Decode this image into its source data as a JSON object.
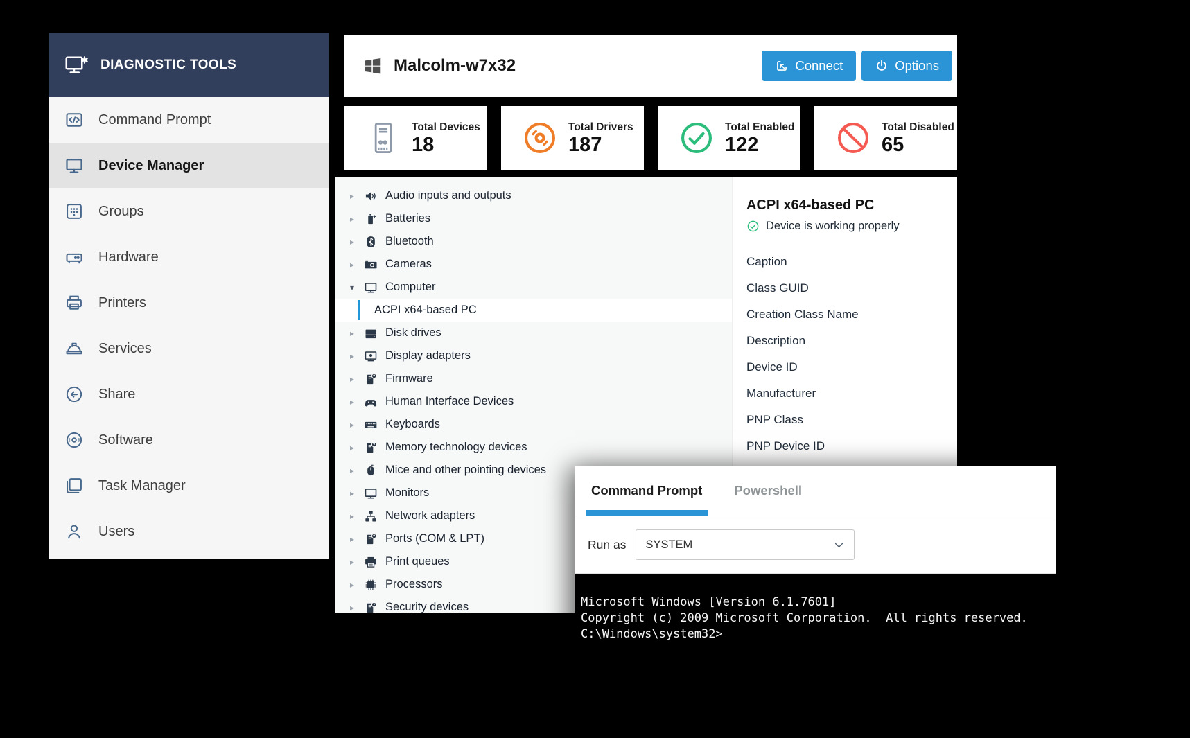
{
  "sidebar": {
    "title": "DIAGNOSTIC TOOLS",
    "items": [
      {
        "label": "Command Prompt",
        "icon": "command-prompt",
        "active": false
      },
      {
        "label": "Device Manager",
        "icon": "device-manager",
        "active": true
      },
      {
        "label": "Groups",
        "icon": "groups",
        "active": false
      },
      {
        "label": "Hardware",
        "icon": "hardware",
        "active": false
      },
      {
        "label": "Printers",
        "icon": "printers",
        "active": false
      },
      {
        "label": "Services",
        "icon": "services",
        "active": false
      },
      {
        "label": "Share",
        "icon": "share",
        "active": false
      },
      {
        "label": "Software",
        "icon": "software",
        "active": false
      },
      {
        "label": "Task Manager",
        "icon": "task-manager",
        "active": false
      },
      {
        "label": "Users",
        "icon": "users",
        "active": false
      }
    ]
  },
  "header": {
    "device_name": "Malcolm-w7x32",
    "connect_label": "Connect",
    "options_label": "Options"
  },
  "stats": [
    {
      "label": "Total Devices",
      "value": "18",
      "icon": "pc-tower",
      "color": "#8e9aa9"
    },
    {
      "label": "Total Drivers",
      "value": "187",
      "icon": "disc",
      "color": "#ef7d28"
    },
    {
      "label": "Total Enabled",
      "value": "122",
      "icon": "check-circle",
      "color": "#2cbd7d"
    },
    {
      "label": "Total Disabled",
      "value": "65",
      "icon": "blocked",
      "color": "#f55a52"
    }
  ],
  "device_tree": {
    "items": [
      {
        "label": "Audio inputs and outputs",
        "icon": "speaker"
      },
      {
        "label": "Batteries",
        "icon": "battery"
      },
      {
        "label": "Bluetooth",
        "icon": "bluetooth"
      },
      {
        "label": "Cameras",
        "icon": "camera"
      },
      {
        "label": "Computer",
        "icon": "monitor",
        "expanded": true,
        "children": [
          {
            "label": "ACPI x64-based PC",
            "selected": true
          }
        ]
      },
      {
        "label": "Disk drives",
        "icon": "disk"
      },
      {
        "label": "Display adapters",
        "icon": "display-adapter"
      },
      {
        "label": "Firmware",
        "icon": "device-unknown"
      },
      {
        "label": "Human Interface Devices",
        "icon": "gamepad"
      },
      {
        "label": "Keyboards",
        "icon": "keyboard"
      },
      {
        "label": "Memory technology devices",
        "icon": "device-unknown"
      },
      {
        "label": "Mice and other pointing devices",
        "icon": "mouse"
      },
      {
        "label": "Monitors",
        "icon": "monitor"
      },
      {
        "label": "Network adapters",
        "icon": "network"
      },
      {
        "label": "Ports (COM & LPT)",
        "icon": "device-unknown"
      },
      {
        "label": "Print queues",
        "icon": "printer"
      },
      {
        "label": "Processors",
        "icon": "processor"
      },
      {
        "label": "Security devices",
        "icon": "device-unknown"
      }
    ]
  },
  "detail_panel": {
    "title": "ACPI x64-based PC",
    "status": "Device is working properly",
    "status_icon": "check-circle",
    "fields": [
      "Caption",
      "Class GUID",
      "Creation Class Name",
      "Description",
      "Device ID",
      "Manufacturer",
      "PNP Class",
      "PNP Device ID"
    ]
  },
  "terminal_window": {
    "tabs": [
      {
        "label": "Command Prompt",
        "active": true
      },
      {
        "label": "Powershell",
        "active": false
      }
    ],
    "run_as_label": "Run as",
    "run_as_value": "SYSTEM",
    "output_lines": [
      "Microsoft Windows [Version 6.1.7601]",
      "Copyright (c) 2009 Microsoft Corporation.  All rights reserved.",
      "C:\\Windows\\system32>"
    ]
  },
  "colors": {
    "accent_blue": "#2a94d6",
    "navy_header": "#313e5c",
    "enabled_green": "#2cbd7d",
    "disabled_red": "#f55a52",
    "drivers_orange": "#ef7d28"
  }
}
